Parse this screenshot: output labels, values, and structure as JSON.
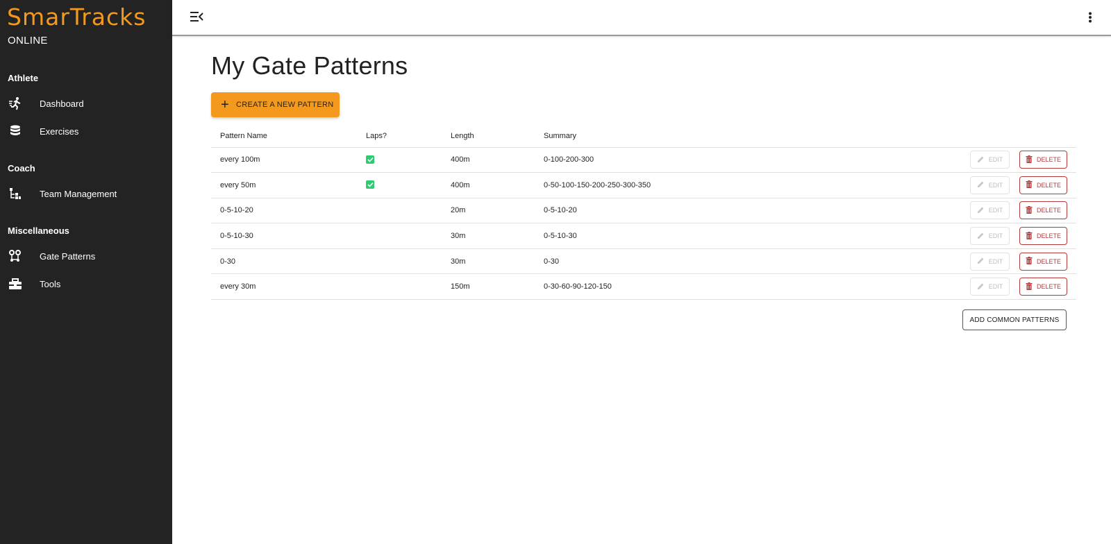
{
  "app": {
    "logo_text": "SmarTracks",
    "logo_sub": "ONLINE",
    "brand_color": "#f39a1e"
  },
  "sidebar": {
    "sections": [
      {
        "title": "Athlete",
        "items": [
          {
            "label": "Dashboard",
            "icon": "runner-icon"
          },
          {
            "label": "Exercises",
            "icon": "database-icon"
          }
        ]
      },
      {
        "title": "Coach",
        "items": [
          {
            "label": "Team Management",
            "icon": "hierarchy-icon"
          }
        ]
      },
      {
        "title": "Miscellaneous",
        "items": [
          {
            "label": "Gate Patterns",
            "icon": "route-icon"
          },
          {
            "label": "Tools",
            "icon": "toolbox-icon"
          }
        ]
      }
    ]
  },
  "topbar": {
    "menu_icon": "menu-collapse-icon",
    "more_icon": "more-vertical-icon"
  },
  "main": {
    "title": "My Gate Patterns",
    "create_label": "CREATE A NEW PATTERN",
    "table": {
      "headers": [
        "Pattern Name",
        "Laps?",
        "Length",
        "Summary"
      ],
      "rows": [
        {
          "name": "every 100m",
          "laps": true,
          "length": "400m",
          "summary": "0-100-200-300"
        },
        {
          "name": "every 50m",
          "laps": true,
          "length": "400m",
          "summary": "0-50-100-150-200-250-300-350"
        },
        {
          "name": "0-5-10-20",
          "laps": false,
          "length": "20m",
          "summary": "0-5-10-20"
        },
        {
          "name": "0-5-10-30",
          "laps": false,
          "length": "30m",
          "summary": "0-5-10-30"
        },
        {
          "name": "0-30",
          "laps": false,
          "length": "30m",
          "summary": "0-30"
        },
        {
          "name": "every 30m",
          "laps": false,
          "length": "150m",
          "summary": "0-30-60-90-120-150"
        }
      ],
      "edit_label": "EDIT",
      "delete_label": "DELETE"
    },
    "add_common_label": "ADD COMMON PATTERNS"
  }
}
